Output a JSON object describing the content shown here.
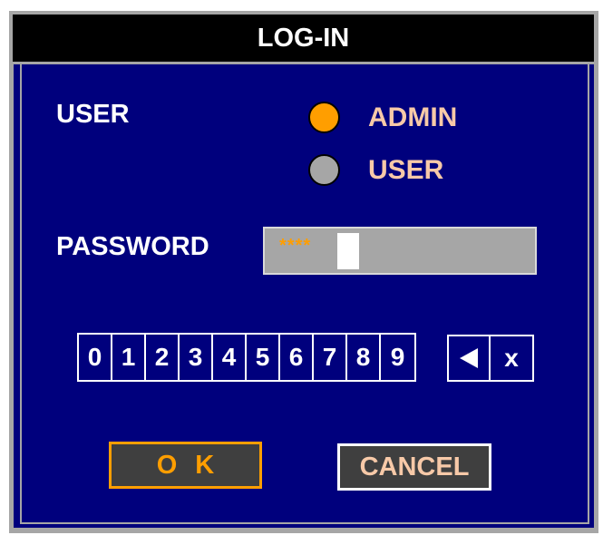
{
  "dialog": {
    "title": "LOG-IN",
    "user_label": "USER",
    "password_label": "PASSWORD"
  },
  "user_options": [
    {
      "label": "ADMIN",
      "selected": true,
      "color": "#ff9e00"
    },
    {
      "label": "USER",
      "selected": false,
      "color": "#a6a6a6"
    }
  ],
  "password": {
    "masked_value": "****",
    "mask_color": "#ff9e00"
  },
  "keypad": {
    "digits": [
      "0",
      "1",
      "2",
      "3",
      "4",
      "5",
      "6",
      "7",
      "8",
      "9"
    ],
    "backspace_icon": "left-triangle-icon",
    "clear_label": "x"
  },
  "buttons": {
    "ok_label": "OK",
    "cancel_label": "CANCEL"
  },
  "colors": {
    "background": "#00007d",
    "titlebar": "#000000",
    "accent": "#ff9e00",
    "option_text": "#f7c9a8"
  }
}
